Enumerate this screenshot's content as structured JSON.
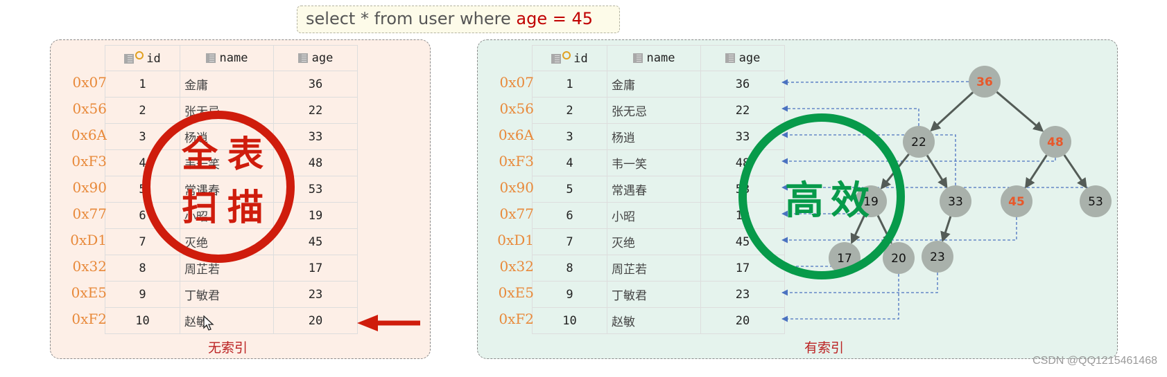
{
  "query": {
    "prefix": "select * from user where ",
    "condition": "age = 45"
  },
  "columns": [
    {
      "label": "id",
      "icon": "primary-key-column-icon"
    },
    {
      "label": "name",
      "icon": "table-column-icon"
    },
    {
      "label": "age",
      "icon": "table-column-icon"
    }
  ],
  "rows": [
    {
      "addr": "0x07",
      "id": "1",
      "name": "金庸",
      "age": "36"
    },
    {
      "addr": "0x56",
      "id": "2",
      "name": "张无忌",
      "age": "22"
    },
    {
      "addr": "0x6A",
      "id": "3",
      "name": "杨逍",
      "age": "33"
    },
    {
      "addr": "0xF3",
      "id": "4",
      "name": "韦一笑",
      "age": "48"
    },
    {
      "addr": "0x90",
      "id": "5",
      "name": "常遇春",
      "age": "53"
    },
    {
      "addr": "0x77",
      "id": "6",
      "name": "小昭",
      "age": "19"
    },
    {
      "addr": "0xD1",
      "id": "7",
      "name": "灭绝",
      "age": "45"
    },
    {
      "addr": "0x32",
      "id": "8",
      "name": "周芷若",
      "age": "17"
    },
    {
      "addr": "0xE5",
      "id": "9",
      "name": "丁敏君",
      "age": "23"
    },
    {
      "addr": "0xF2",
      "id": "10",
      "name": "赵敏",
      "age": "20"
    }
  ],
  "left_panel": {
    "caption": "无索引",
    "stamp": [
      "全表",
      "扫描"
    ]
  },
  "right_panel": {
    "caption": "有索引",
    "stamp": "高效"
  },
  "tree": {
    "nodes": [
      {
        "key": "36",
        "highlight": true
      },
      {
        "key": "22",
        "highlight": false
      },
      {
        "key": "48",
        "highlight": true
      },
      {
        "key": "19",
        "highlight": false
      },
      {
        "key": "33",
        "highlight": false
      },
      {
        "key": "45",
        "highlight": true
      },
      {
        "key": "53",
        "highlight": false
      },
      {
        "key": "17",
        "highlight": false
      },
      {
        "key": "20",
        "highlight": false
      },
      {
        "key": "23",
        "highlight": false
      }
    ],
    "edges": [
      [
        "36",
        "22"
      ],
      [
        "36",
        "48"
      ],
      [
        "22",
        "19"
      ],
      [
        "22",
        "33"
      ],
      [
        "48",
        "45"
      ],
      [
        "48",
        "53"
      ],
      [
        "19",
        "17"
      ],
      [
        "19",
        "20"
      ],
      [
        "33",
        "23"
      ]
    ]
  },
  "colors": {
    "highlight": "#e8582a",
    "node_fill": "#a9b1ab",
    "pointer_line": "#4a72c0",
    "edge": "#545c57",
    "stamp_red": "#cf1c0c",
    "stamp_green": "#079a4a"
  },
  "watermark": "CSDN @QQ1215461468"
}
